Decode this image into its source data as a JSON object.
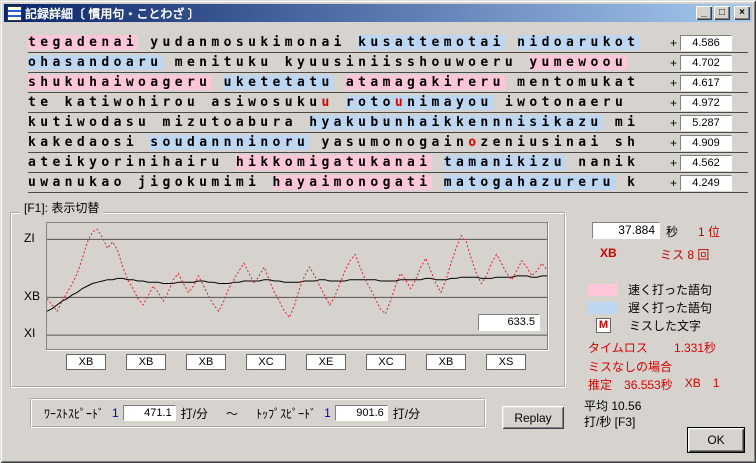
{
  "window": {
    "title": "記録詳細〔 慣用句・ことわざ 〕",
    "controls": [
      {
        "name": "minimize",
        "glyph": "_"
      },
      {
        "name": "maximize",
        "glyph": "□"
      },
      {
        "name": "close",
        "glyph": "×"
      }
    ]
  },
  "rows": [
    {
      "segments": [
        {
          "t": "tegadenai",
          "c": "fast"
        },
        {
          "t": " yudanmosukimonai ",
          "c": ""
        },
        {
          "t": "kusattemotai",
          "c": "slow"
        },
        {
          "t": " ",
          "c": ""
        },
        {
          "t": "nidoarukot",
          "c": "slow"
        }
      ],
      "plus": "+",
      "value": "4.586"
    },
    {
      "segments": [
        {
          "t": "ohasandoaru",
          "c": "slow"
        },
        {
          "t": " menituku kyuusiniisshouwoeru ",
          "c": ""
        },
        {
          "t": "yumewoou",
          "c": "fast"
        }
      ],
      "plus": "+",
      "value": "4.702"
    },
    {
      "segments": [
        {
          "t": "shukuhaiwoageru",
          "c": "fast"
        },
        {
          "t": " ",
          "c": ""
        },
        {
          "t": "uketetatu",
          "c": "slow"
        },
        {
          "t": " ",
          "c": ""
        },
        {
          "t": "atamagakireru",
          "c": "fast"
        },
        {
          "t": " mentomukat",
          "c": ""
        }
      ],
      "plus": "+",
      "value": "4.617"
    },
    {
      "segments": [
        {
          "t": "te katiwohirou asiwosuku",
          "c": ""
        },
        {
          "t": "u",
          "c": "miss"
        },
        {
          "t": " ",
          "c": ""
        },
        {
          "t": "roto",
          "c": "slow"
        },
        {
          "t": "u",
          "c": "slow miss"
        },
        {
          "t": "nimayou",
          "c": "slow"
        },
        {
          "t": " iwotonaeru",
          "c": ""
        }
      ],
      "plus": "+",
      "value": "4.972"
    },
    {
      "segments": [
        {
          "t": "kutiwodasu mizutoabura ",
          "c": ""
        },
        {
          "t": "hyakubunhaikkennnisikazu",
          "c": "slow"
        },
        {
          "t": " mi",
          "c": ""
        }
      ],
      "plus": "+",
      "value": "5.287"
    },
    {
      "segments": [
        {
          "t": "kakedaosi ",
          "c": ""
        },
        {
          "t": "soudannninoru",
          "c": "slow"
        },
        {
          "t": " yasumonogain",
          "c": ""
        },
        {
          "t": "o",
          "c": "miss"
        },
        {
          "t": "zeniusinai sh",
          "c": ""
        }
      ],
      "plus": "+",
      "value": "4.909"
    },
    {
      "segments": [
        {
          "t": "ateikyorinihairu ",
          "c": ""
        },
        {
          "t": "hikkomigatukanai",
          "c": "fast"
        },
        {
          "t": " ",
          "c": ""
        },
        {
          "t": "tamanikizu",
          "c": "slow"
        },
        {
          "t": " nanik",
          "c": ""
        }
      ],
      "plus": "+",
      "value": "4.562"
    },
    {
      "segments": [
        {
          "t": "uwanukao jigokumimi ",
          "c": ""
        },
        {
          "t": "hayaimonogati",
          "c": "fast"
        },
        {
          "t": " ",
          "c": ""
        },
        {
          "t": "matogahazureru",
          "c": "slow"
        },
        {
          "t": " k",
          "c": ""
        }
      ],
      "plus": "+",
      "value": "4.249"
    }
  ],
  "graph": {
    "group_label": "[F1]: 表示切替",
    "type": "line",
    "y_levels": [
      {
        "label": "ZI",
        "pos": 0.87
      },
      {
        "label": "XB",
        "pos": 0.41
      },
      {
        "label": "XI",
        "pos": 0.11
      }
    ],
    "current": "633.5",
    "laps": [
      "XB",
      "XB",
      "XB",
      "XC",
      "XE",
      "XC",
      "XB",
      "XS"
    ],
    "series": {
      "instant": [
        0.4,
        0.35,
        0.3,
        0.38,
        0.45,
        0.52,
        0.6,
        0.72,
        0.85,
        0.93,
        0.95,
        0.88,
        0.8,
        0.85,
        0.78,
        0.65,
        0.55,
        0.48,
        0.4,
        0.35,
        0.42,
        0.5,
        0.45,
        0.38,
        0.45,
        0.55,
        0.6,
        0.52,
        0.45,
        0.5,
        0.58,
        0.5,
        0.42,
        0.35,
        0.3,
        0.38,
        0.48,
        0.55,
        0.62,
        0.68,
        0.6,
        0.52,
        0.58,
        0.65,
        0.55,
        0.45,
        0.38,
        0.3,
        0.25,
        0.35,
        0.48,
        0.58,
        0.65,
        0.58,
        0.5,
        0.42,
        0.35,
        0.42,
        0.52,
        0.62,
        0.7,
        0.75,
        0.65,
        0.55,
        0.48,
        0.4,
        0.32,
        0.28,
        0.38,
        0.5,
        0.6,
        0.55,
        0.48,
        0.55,
        0.65,
        0.72,
        0.62,
        0.52,
        0.45,
        0.55,
        0.68,
        0.8,
        0.9,
        0.85,
        0.72,
        0.6,
        0.52,
        0.58,
        0.68,
        0.75,
        0.68,
        0.6,
        0.55,
        0.62,
        0.7,
        0.65,
        0.58,
        0.62,
        0.68,
        0.63
      ],
      "average": [
        0.3,
        0.32,
        0.35,
        0.38,
        0.4,
        0.43,
        0.45,
        0.48,
        0.5,
        0.52,
        0.53,
        0.54,
        0.55,
        0.55,
        0.56,
        0.56,
        0.55,
        0.55,
        0.54,
        0.54,
        0.53,
        0.53,
        0.53,
        0.52,
        0.52,
        0.52,
        0.53,
        0.53,
        0.53,
        0.53,
        0.54,
        0.54,
        0.53,
        0.53,
        0.52,
        0.52,
        0.52,
        0.53,
        0.53,
        0.54,
        0.54,
        0.54,
        0.54,
        0.55,
        0.55,
        0.54,
        0.54,
        0.53,
        0.53,
        0.53,
        0.53,
        0.54,
        0.54,
        0.54,
        0.55,
        0.55,
        0.54,
        0.54,
        0.54,
        0.54,
        0.55,
        0.55,
        0.55,
        0.55,
        0.55,
        0.55,
        0.54,
        0.54,
        0.54,
        0.54,
        0.55,
        0.55,
        0.55,
        0.55,
        0.55,
        0.56,
        0.56,
        0.55,
        0.55,
        0.55,
        0.56,
        0.56,
        0.57,
        0.57,
        0.57,
        0.57,
        0.56,
        0.56,
        0.56,
        0.57,
        0.57,
        0.57,
        0.57,
        0.58,
        0.58,
        0.58,
        0.57,
        0.57,
        0.58,
        0.58
      ]
    }
  },
  "result": {
    "time": "37.884",
    "time_unit": "秒",
    "rank": "1 位",
    "grade": "XB",
    "miss": "ミス 8 回"
  },
  "legend": [
    {
      "label": "速く打った語句"
    },
    {
      "label": "遅く打った語句"
    },
    {
      "mark": "M",
      "label": "ミスした文字"
    }
  ],
  "analysis": {
    "timeloss_label": "タイムロス",
    "timeloss_value": "1.331秒",
    "no_miss": "ミスなしの場合",
    "est_label": "推定",
    "est_value": "36.553秒",
    "est_grade": "XB",
    "est_rank": "1"
  },
  "average": {
    "line1": "平均 10.56",
    "line2": "打/秒 [F3]"
  },
  "speed": {
    "worst_label": "ﾜｰｽﾄｽﾋﾟｰﾄﾞ",
    "worst_n": "1",
    "worst_value": "471.1",
    "unit": "打/分",
    "tilde": "～",
    "top_label": "ﾄｯﾌﾟｽﾋﾟｰﾄﾞ",
    "top_n": "1",
    "top_value": "901.6"
  },
  "buttons": {
    "replay": "Replay",
    "ok": "OK"
  },
  "colors": {
    "fast_highlight": "#ffc6d9",
    "slow_highlight": "#bdd7f2",
    "miss_text": "#e00000",
    "red_text": "#cc0000",
    "titlebar_left": "#0a246a",
    "titlebar_right": "#a6caf0"
  }
}
